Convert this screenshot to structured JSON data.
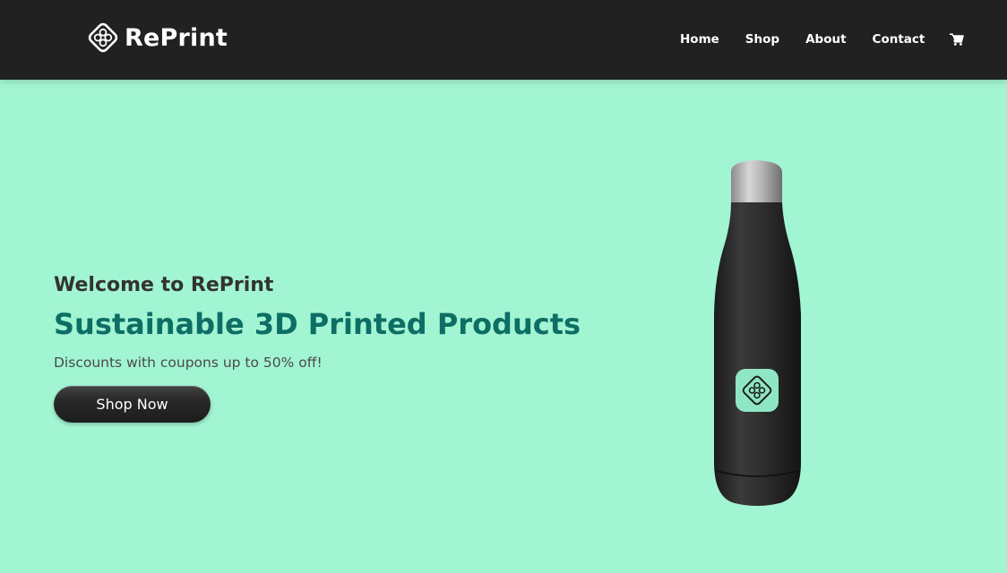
{
  "header": {
    "brand_name": "RePrint",
    "logo_icon": "reprint-logo-icon",
    "nav": [
      {
        "label": "Home"
      },
      {
        "label": "Shop"
      },
      {
        "label": "About"
      },
      {
        "label": "Contact"
      }
    ],
    "cart_icon": "shopping-cart-icon"
  },
  "hero": {
    "welcome": "Welcome to RePrint",
    "headline": "Sustainable 3D Printed Products",
    "subtext": "Discounts with coupons up to 50% off!",
    "cta_label": "Shop Now",
    "product_image": "water-bottle-image"
  },
  "colors": {
    "background": "#a2f5d3",
    "navbar": "#212121",
    "headline": "#0d6e64",
    "welcome": "#333333",
    "button": "#222222"
  }
}
